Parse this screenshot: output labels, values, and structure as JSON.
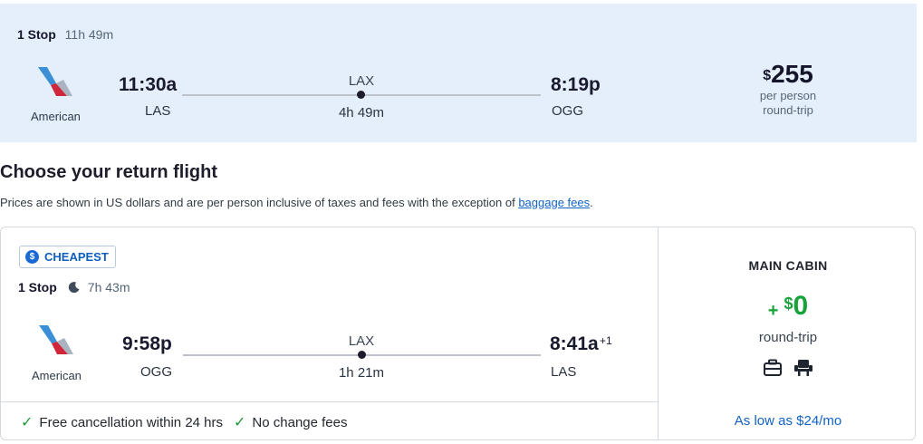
{
  "outbound": {
    "stops": "1 Stop",
    "duration": "11h 49m",
    "airline": "American",
    "depart_time": "11:30a",
    "depart_airport": "LAS",
    "via": "LAX",
    "leg_duration": "4h 49m",
    "arrive_time": "8:19p",
    "arrive_airport": "OGG",
    "price_currency": "$",
    "price_amount": "255",
    "price_line1": "per person",
    "price_line2": "round-trip"
  },
  "section": {
    "title": "Choose your return flight",
    "disclaimer": "Prices are shown in US dollars and are per person inclusive of taxes and fees with the exception of",
    "disclaimer_link": "baggage fees",
    "disclaimer_end": "."
  },
  "return": {
    "badge": "CHEAPEST",
    "stops": "1 Stop",
    "duration": "7h 43m",
    "airline": "American",
    "depart_time": "9:58p",
    "depart_airport": "OGG",
    "via": "LAX",
    "leg_duration": "1h 21m",
    "arrive_time": "8:41a",
    "arrive_day_offset": "+1",
    "arrive_airport": "LAS",
    "features": [
      "Free cancellation within 24 hrs",
      "No change fees"
    ],
    "cabin": "MAIN CABIN",
    "upgrade_plus": "+",
    "upgrade_currency": "$",
    "upgrade_amount": "0",
    "upgrade_label": "round-trip",
    "financing": "As low as $24/mo"
  },
  "colors": {
    "outbound_bg": "#e4effb",
    "link": "#0f64c8",
    "price_green": "#17a33a",
    "check_green": "#1f9a3b"
  },
  "icons": [
    "american-airlines-logo-icon",
    "moon-icon",
    "dollar-badge-icon",
    "check-icon",
    "carry-on-bag-icon",
    "seat-icon"
  ]
}
